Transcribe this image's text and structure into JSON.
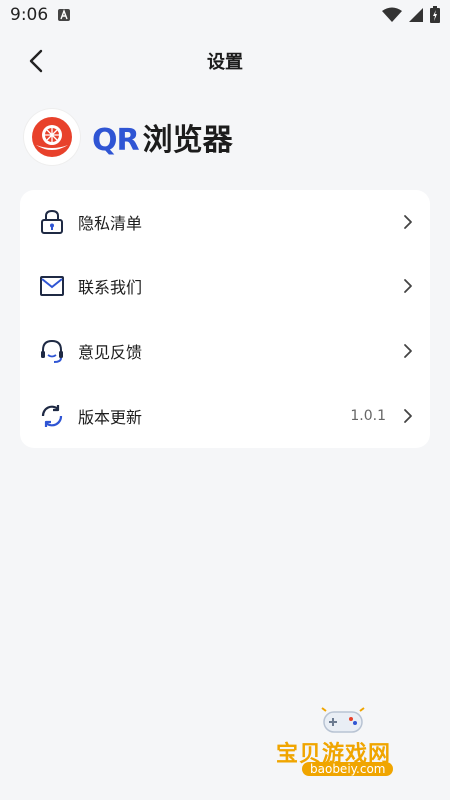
{
  "status_bar": {
    "time": "9:06",
    "icons": [
      "a-icon",
      "wifi-icon",
      "signal-icon",
      "battery-icon"
    ]
  },
  "header": {
    "title": "设置",
    "back_icon": "chevron-left-icon"
  },
  "brand": {
    "qr": "QR",
    "name": "浏览器",
    "logo_icon": "app-logo-icon"
  },
  "menu": {
    "items": [
      {
        "label": "隐私清单",
        "icon": "lock-icon",
        "value": ""
      },
      {
        "label": "联系我们",
        "icon": "mail-icon",
        "value": ""
      },
      {
        "label": "意见反馈",
        "icon": "headset-icon",
        "value": ""
      },
      {
        "label": "版本更新",
        "icon": "refresh-icon",
        "value": "1.0.1"
      }
    ]
  },
  "watermark": {
    "text": "宝贝游戏网",
    "url": "baobeiy.com"
  },
  "colors": {
    "background": "#f5f6f8",
    "card": "#ffffff",
    "brand_blue": "#2f55d4",
    "watermark": "#f0a500"
  }
}
